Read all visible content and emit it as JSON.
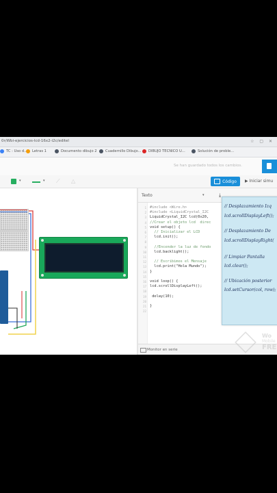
{
  "browser": {
    "url": "0r/Wbi-ejercicios-lcd-16x2-i2c/editel",
    "bookmarks": [
      {
        "label": "TC : Uso d...",
        "color": "#3b82f6"
      },
      {
        "label": "Letras 1",
        "color": "#f59e0b"
      },
      {
        "label": "Documento dibujo 2",
        "color": "#4b5563"
      },
      {
        "label": "Cuadernillo Dibujo...",
        "color": "#4b5563"
      },
      {
        "label": "DIBUJO TECNICO U...",
        "color": "#dc2626"
      },
      {
        "label": "Solución de proble...",
        "color": "#4b5563"
      }
    ]
  },
  "header": {
    "save_status": "Se han guardado todos los cambios."
  },
  "toolbar": {
    "code_label": "Código",
    "simulate_label": "Iniciar simu"
  },
  "editor": {
    "mode_label": "Texto",
    "line_numbers": [
      "1",
      "2",
      "3",
      "4",
      "5",
      "6",
      "7",
      "8",
      "9",
      "10",
      "11",
      "12",
      "13",
      "14",
      "15",
      "16",
      "17",
      "18",
      "19",
      "20",
      "21",
      "22"
    ],
    "lines": [
      "#include <Wire.h>",
      "#include <LiquidCrystal_I2C",
      "LiquidCrystal_I2C lcd(0x20,",
      "",
      "void setup() {",
      "  // Inicializar el LCD",
      "  lcd.init();",
      "",
      "  //Encender la luz de fondo",
      "  lcd.backlight();",
      "",
      "  // Escribimos el Mensaje",
      "  lcd.print(\"Hola Mundo\");",
      "}",
      "",
      "void loop() {",
      "lcd.scrollDisplayLeft();",
      "",
      " delay(10);",
      "",
      "}"
    ],
    "line_kinds": [
      "dir",
      "dir",
      "code",
      "code",
      "code",
      "comment",
      "code",
      "code",
      "comment",
      "code",
      "code",
      "comment",
      "code",
      "code",
      "code",
      "code",
      "code",
      "code",
      "code",
      "code",
      "code"
    ],
    "comment_line": "//Crear el objeto lcd  direc",
    "monitor_label": "Monitor en serie"
  },
  "notes": {
    "lines": [
      "// Desplazamiento Izq",
      "lcd.scrollDisplayLeft();",
      "// Desplazamiento De",
      "lcd.scrollDisplayRight(",
      "// Limpiar Pantalla",
      "lcd.clear();",
      "// Ubicación posterior",
      "lcd.setCursor(col, row);"
    ]
  },
  "watermark": {
    "line1": "Wo",
    "line2": "Mobile",
    "line3": "FRE"
  },
  "colors": {
    "accent": "#1a8fd9",
    "lcd_board": "#19a85a",
    "note_bg": "#cde8f3"
  }
}
